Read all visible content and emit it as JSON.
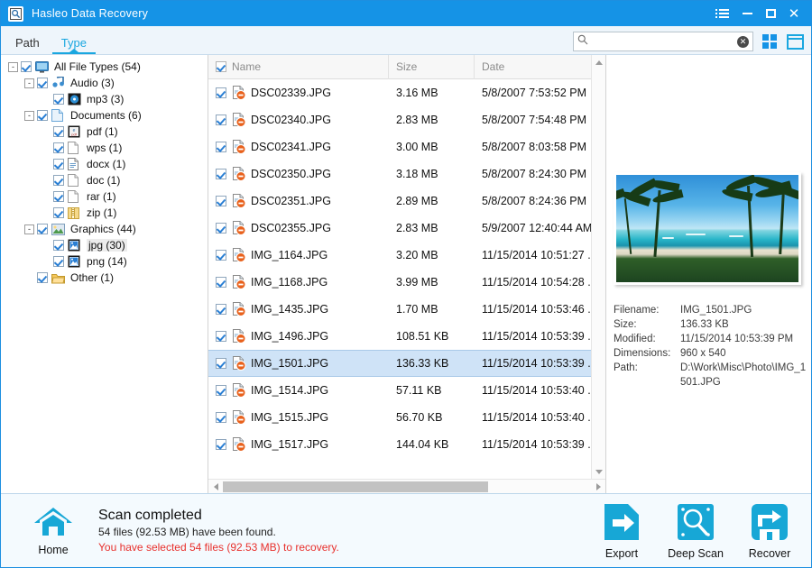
{
  "window": {
    "title": "Hasleo Data Recovery",
    "app_icon": "magnifier-icon",
    "controls": {
      "menu": "menu-icon",
      "minimize": "minimize-icon",
      "maximize": "maximize-icon",
      "close": "close-icon"
    }
  },
  "accent_color": "#1593e6",
  "tabs": [
    {
      "label": "Path",
      "active": false
    },
    {
      "label": "Type",
      "active": true
    }
  ],
  "search": {
    "value": "",
    "placeholder": ""
  },
  "view_buttons": [
    {
      "name": "grid-view",
      "active": false
    },
    {
      "name": "panel-view",
      "active": true
    }
  ],
  "tree": {
    "items": [
      {
        "label": "All File Types (54)",
        "depth": 0,
        "expander": "-",
        "checked": true,
        "icon": "monitor-icon",
        "highlight": false
      },
      {
        "label": "Audio (3)",
        "depth": 1,
        "expander": "-",
        "checked": true,
        "icon": "music-icon",
        "highlight": false
      },
      {
        "label": "mp3 (3)",
        "depth": 2,
        "expander": "",
        "checked": true,
        "icon": "mp3-icon",
        "highlight": false
      },
      {
        "label": "Documents (6)",
        "depth": 1,
        "expander": "-",
        "checked": true,
        "icon": "document-icon",
        "highlight": false
      },
      {
        "label": "pdf (1)",
        "depth": 2,
        "expander": "",
        "checked": true,
        "icon": "pdf-icon",
        "highlight": false
      },
      {
        "label": "wps (1)",
        "depth": 2,
        "expander": "",
        "checked": true,
        "icon": "blank-page-icon",
        "highlight": false
      },
      {
        "label": "docx (1)",
        "depth": 2,
        "expander": "",
        "checked": true,
        "icon": "doc-lines-icon",
        "highlight": false
      },
      {
        "label": "doc (1)",
        "depth": 2,
        "expander": "",
        "checked": true,
        "icon": "blank-page-icon",
        "highlight": false
      },
      {
        "label": "rar (1)",
        "depth": 2,
        "expander": "",
        "checked": true,
        "icon": "blank-page-icon",
        "highlight": false
      },
      {
        "label": "zip (1)",
        "depth": 2,
        "expander": "",
        "checked": true,
        "icon": "zip-icon",
        "highlight": false
      },
      {
        "label": "Graphics (44)",
        "depth": 1,
        "expander": "-",
        "checked": true,
        "icon": "image-icon",
        "highlight": false
      },
      {
        "label": "jpg (30)",
        "depth": 2,
        "expander": "",
        "checked": true,
        "icon": "picture-icon",
        "highlight": true
      },
      {
        "label": "png (14)",
        "depth": 2,
        "expander": "",
        "checked": true,
        "icon": "picture-icon",
        "highlight": false
      },
      {
        "label": "Other (1)",
        "depth": 1,
        "expander": "",
        "checked": true,
        "icon": "folder-icon",
        "highlight": false
      }
    ]
  },
  "filelist": {
    "columns": [
      "Name",
      "Size",
      "Date"
    ],
    "header_checked": true,
    "rows": [
      {
        "name": "DSC02339.JPG",
        "size": "3.16 MB",
        "date": "5/8/2007 7:53:52 PM",
        "checked": true,
        "selected": false
      },
      {
        "name": "DSC02340.JPG",
        "size": "2.83 MB",
        "date": "5/8/2007 7:54:48 PM",
        "checked": true,
        "selected": false
      },
      {
        "name": "DSC02341.JPG",
        "size": "3.00 MB",
        "date": "5/8/2007 8:03:58 PM",
        "checked": true,
        "selected": false
      },
      {
        "name": "DSC02350.JPG",
        "size": "3.18 MB",
        "date": "5/8/2007 8:24:30 PM",
        "checked": true,
        "selected": false
      },
      {
        "name": "DSC02351.JPG",
        "size": "2.89 MB",
        "date": "5/8/2007 8:24:36 PM",
        "checked": true,
        "selected": false
      },
      {
        "name": "DSC02355.JPG",
        "size": "2.83 MB",
        "date": "5/9/2007 12:40:44 AM",
        "checked": true,
        "selected": false
      },
      {
        "name": "IMG_1164.JPG",
        "size": "3.20 MB",
        "date": "11/15/2014 10:51:27 ..",
        "checked": true,
        "selected": false
      },
      {
        "name": "IMG_1168.JPG",
        "size": "3.99 MB",
        "date": "11/15/2014 10:54:28 ..",
        "checked": true,
        "selected": false
      },
      {
        "name": "IMG_1435.JPG",
        "size": "1.70 MB",
        "date": "11/15/2014 10:53:46 ..",
        "checked": true,
        "selected": false
      },
      {
        "name": "IMG_1496.JPG",
        "size": "108.51 KB",
        "date": "11/15/2014 10:53:39 ..",
        "checked": true,
        "selected": false
      },
      {
        "name": "IMG_1501.JPG",
        "size": "136.33 KB",
        "date": "11/15/2014 10:53:39 ..",
        "checked": true,
        "selected": true
      },
      {
        "name": "IMG_1514.JPG",
        "size": "57.11 KB",
        "date": "11/15/2014 10:53:40 ..",
        "checked": true,
        "selected": false
      },
      {
        "name": "IMG_1515.JPG",
        "size": "56.70 KB",
        "date": "11/15/2014 10:53:40 ..",
        "checked": true,
        "selected": false
      },
      {
        "name": "IMG_1517.JPG",
        "size": "144.04 KB",
        "date": "11/15/2014 10:53:39 ..",
        "checked": true,
        "selected": false
      }
    ]
  },
  "preview": {
    "image_alt": "tropical-beach-photo",
    "fields": [
      {
        "key": "Filename:",
        "value": "IMG_1501.JPG"
      },
      {
        "key": "Size:",
        "value": "136.33 KB"
      },
      {
        "key": "Modified:",
        "value": "11/15/2014 10:53:39 PM"
      },
      {
        "key": "Dimensions:",
        "value": "960 x 540"
      },
      {
        "key": "Path:",
        "value": "D:\\Work\\Misc\\Photo\\IMG_1501.JPG"
      }
    ]
  },
  "status": {
    "home_label": "Home",
    "title": "Scan completed",
    "found": "54 files (92.53 MB) have been found.",
    "selected": "You have selected 54 files (92.53 MB) to recovery.",
    "warn_color": "#e8302c",
    "actions": [
      {
        "label": "Export",
        "icon": "export-icon"
      },
      {
        "label": "Deep Scan",
        "icon": "deep-scan-icon"
      },
      {
        "label": "Recover",
        "icon": "recover-icon"
      }
    ]
  }
}
